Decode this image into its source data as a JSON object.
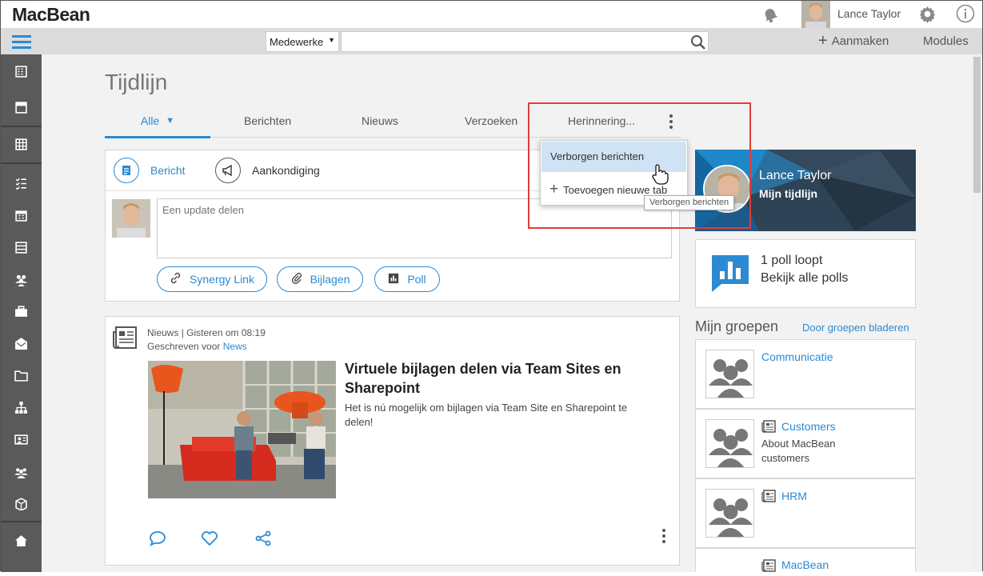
{
  "app": {
    "logo": "MacBean"
  },
  "user": {
    "name": "Lance Taylor"
  },
  "toolbar": {
    "search_scope": "Medewerke",
    "search_placeholder": "",
    "create_label": "Aanmaken",
    "modules_label": "Modules"
  },
  "page": {
    "title": "Tijdlijn"
  },
  "tabs": [
    {
      "label": "Alle",
      "active": true
    },
    {
      "label": "Berichten"
    },
    {
      "label": "Nieuws"
    },
    {
      "label": "Verzoeken"
    },
    {
      "label": "Herinnering..."
    }
  ],
  "composer": {
    "post_type_1": "Bericht",
    "post_type_2": "Aankondiging",
    "placeholder": "Een update delen",
    "btn_link": "Synergy Link",
    "btn_attach": "Bijlagen",
    "btn_poll": "Poll"
  },
  "dropdown": {
    "item1": "Verborgen berichten",
    "item2": "Toevoegen nieuwe tab",
    "tooltip": "Verborgen berichten"
  },
  "news": {
    "meta_type": "Nieuws",
    "meta_time": "Gisteren om 08:19",
    "written_for_label": "Geschreven voor",
    "written_for_link": "News",
    "title": "Virtuele bijlagen delen via Team Sites en Sharepoint",
    "body": "Het is nú mogelijk om bijlagen via Team Site en Sharepoint te delen!"
  },
  "profile_card": {
    "name": "Lance Taylor",
    "subtitle": "Mijn tijdlijn"
  },
  "polls": {
    "line1": "1 poll loopt",
    "line2": "Bekijk alle polls"
  },
  "groups": {
    "heading": "Mijn groepen",
    "browse_link": "Door groepen bladeren",
    "items": [
      {
        "name": "Communicatie",
        "desc": ""
      },
      {
        "name": "Customers",
        "desc": "About MacBean customers"
      },
      {
        "name": "HRM",
        "desc": ""
      },
      {
        "name": "MacBean",
        "desc": ""
      }
    ]
  },
  "colors": {
    "accent": "#2b8ad2",
    "highlight": "#e03c3c",
    "sidebar": "#5a5a5a"
  }
}
